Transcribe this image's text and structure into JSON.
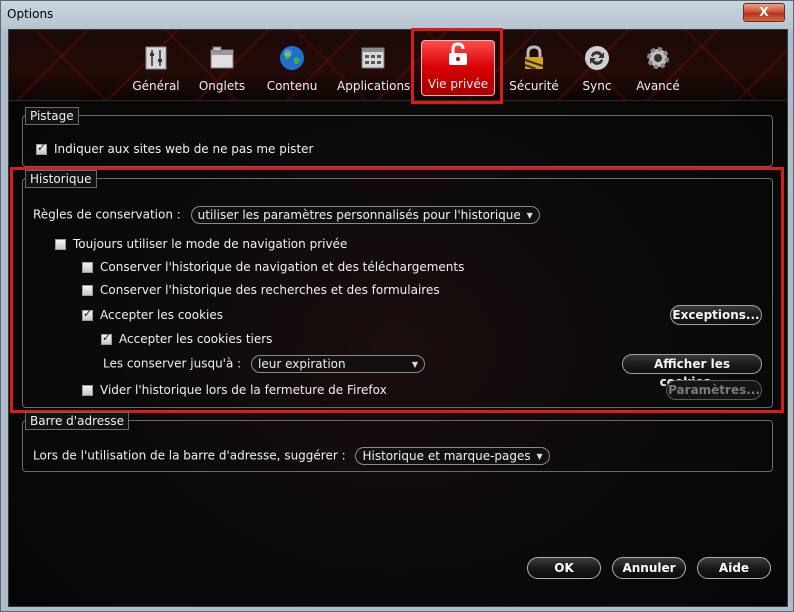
{
  "window": {
    "title": "Options",
    "close_label": "X"
  },
  "tabs": [
    {
      "label": "Général",
      "icon": "general-icon"
    },
    {
      "label": "Onglets",
      "icon": "tabs-icon"
    },
    {
      "label": "Contenu",
      "icon": "globe-icon"
    },
    {
      "label": "Applications",
      "icon": "applications-icon"
    },
    {
      "label": "Vie privée",
      "icon": "privacy-mask-icon",
      "active": true
    },
    {
      "label": "Sécurité",
      "icon": "lock-icon"
    },
    {
      "label": "Sync",
      "icon": "sync-icon"
    },
    {
      "label": "Avancé",
      "icon": "gear-icon"
    }
  ],
  "tracking": {
    "legend": "Pistage",
    "dnt_label": "Indiquer aux sites web de ne pas me pister",
    "dnt_checked": true
  },
  "history": {
    "legend": "Historique",
    "rules_label": "Règles de conservation :",
    "rules_value": "utiliser les paramètres personnalisés pour l'historique",
    "private_label": "Toujours utiliser le mode de navigation privée",
    "private_checked": false,
    "keep_browsing_label": "Conserver l'historique de navigation et des téléchargements",
    "keep_browsing_checked": false,
    "keep_search_label": "Conserver l'historique des recherches et des formulaires",
    "keep_search_checked": false,
    "accept_cookies_label": "Accepter les cookies",
    "accept_cookies_checked": true,
    "exceptions_button": "Exceptions...",
    "third_party_label": "Accepter les cookies tiers",
    "third_party_checked": true,
    "keep_until_label": "Les conserver jusqu'à :",
    "keep_until_value": "leur expiration",
    "show_cookies_button": "Afficher les cookies...",
    "clear_on_close_label": "Vider l'historique lors de la fermeture de Firefox",
    "clear_on_close_checked": false,
    "settings_button": "Paramètres..."
  },
  "location_bar": {
    "legend": "Barre d'adresse",
    "suggest_label": "Lors de l'utilisation de la barre d'adresse, suggérer :",
    "suggest_value": "Historique et marque-pages"
  },
  "buttons": {
    "ok": "OK",
    "cancel": "Annuler",
    "help": "Aide"
  },
  "colors": {
    "accent_red": "#d81c1c",
    "active_tab": "#d60000",
    "background": "#0a0a0a"
  }
}
